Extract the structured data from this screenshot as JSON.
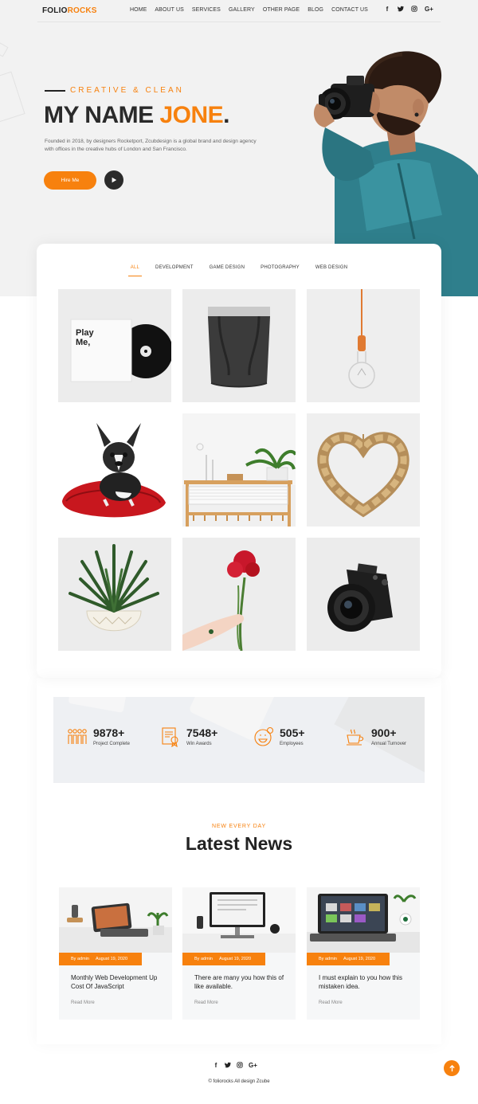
{
  "nav": {
    "logo_first": "FOLIO",
    "logo_second": "ROCKS",
    "items": [
      "HOME",
      "ABOUT US",
      "SERVICES",
      "GALLERY",
      "OTHER PAGE",
      "BLOG",
      "CONTACT US"
    ],
    "socials": [
      "f",
      "t",
      "o",
      "G+"
    ]
  },
  "hero": {
    "tagline": "CREATIVE & CLEAN",
    "headline_prefix": "MY NAME ",
    "headline_name": "JONE",
    "headline_suffix": ".",
    "intro": "Founded in 2018, by designers Rocketport, Zcubdesign is a global brand and design agency with offices in the creative hubs of London and San Francisco.",
    "hire_label": "Hire Me",
    "play_icon": "play-icon",
    "photo_icon": "photographer-image"
  },
  "portfolio": {
    "filters": [
      "ALL",
      "DEVELOPMENT",
      "GAME DESIGN",
      "PHOTOGRAPHY",
      "WEB DESIGN"
    ],
    "active_filter": "ALL",
    "album_text": "Play Me,",
    "tiles": [
      "cd-album",
      "fabric-bag",
      "pendant-bulb",
      "french-bulldog",
      "plant-shelf",
      "wooden-heart",
      "potted-succulent",
      "red-carnation",
      "camera"
    ]
  },
  "stats": [
    {
      "value": "9878+",
      "label": "Project Complete",
      "icon": "people-icon"
    },
    {
      "value": "7548+",
      "label": "Win Awards",
      "icon": "certificate-icon"
    },
    {
      "value": "505+",
      "label": "Employees",
      "icon": "smile-icon"
    },
    {
      "value": "900+",
      "label": "Annual Turnover",
      "icon": "coffee-icon"
    }
  ],
  "news": {
    "subtitle": "NEW EVERY DAY",
    "title": "Latest News",
    "read_more": "Read More",
    "posts": [
      {
        "author": "By admin",
        "date": "August 19, 2020",
        "title": "Monthly Web Development Up Cost Of JavaScript"
      },
      {
        "author": "By admin",
        "date": "August 19, 2020",
        "title": "There are many you how this of like available."
      },
      {
        "author": "By admin",
        "date": "August 19, 2020",
        "title": "I must explain to you how this mistaken idea."
      }
    ]
  },
  "footer": {
    "socials": [
      "f",
      "t",
      "o",
      "G+"
    ],
    "copyright": "© foliorocks All design Zcube"
  },
  "colors": {
    "accent": "#f7810e",
    "dark": "#2a2a2a",
    "hero_bg": "#f2f2f2"
  }
}
